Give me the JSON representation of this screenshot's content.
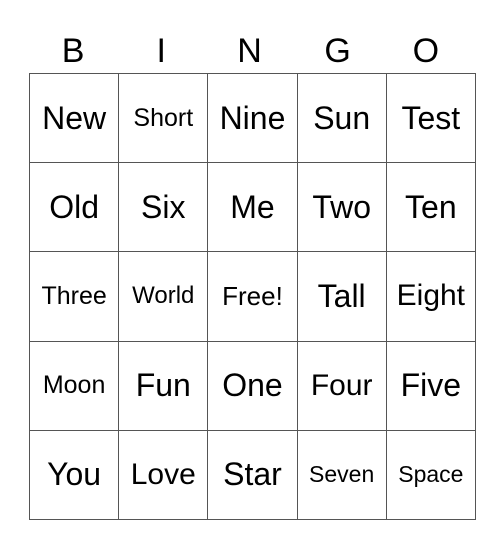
{
  "header": [
    "B",
    "I",
    "N",
    "G",
    "O"
  ],
  "grid": [
    [
      "New",
      "Short",
      "Nine",
      "Sun",
      "Test"
    ],
    [
      "Old",
      "Six",
      "Me",
      "Two",
      "Ten"
    ],
    [
      "Three",
      "World",
      "Free!",
      "Tall",
      "Eight"
    ],
    [
      "Moon",
      "Fun",
      "One",
      "Four",
      "Five"
    ],
    [
      "You",
      "Love",
      "Star",
      "Seven",
      "Space"
    ]
  ]
}
